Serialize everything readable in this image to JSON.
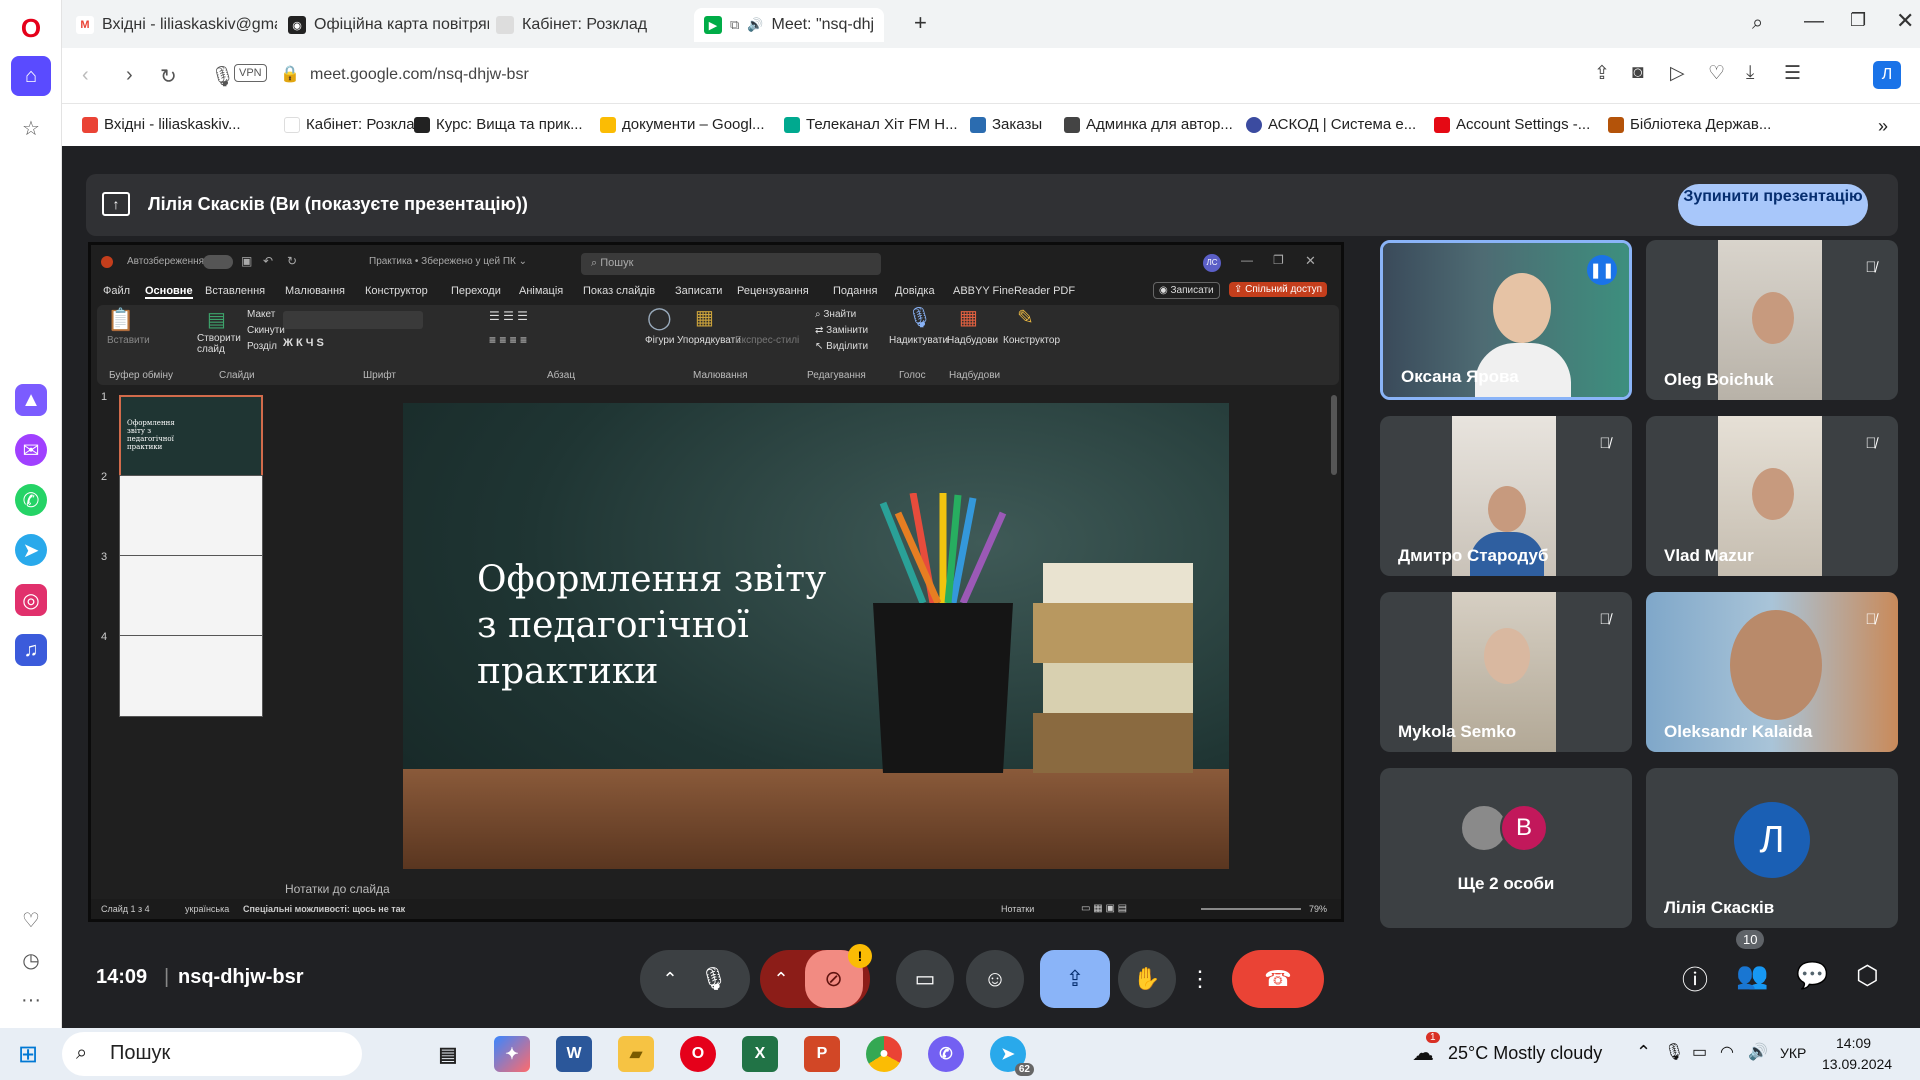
{
  "browser": {
    "tabs": [
      {
        "title": "Вхідні - liliaskaskiv@gmail",
        "icon": "gmail-icon",
        "active": false
      },
      {
        "title": "Офіційна карта повітрян",
        "icon": "map-icon",
        "active": false
      },
      {
        "title": "Кабінет: Розклад",
        "icon": "page-icon",
        "active": false
      },
      {
        "title": "Meet: \"nsq-dhjw-b",
        "icon": "meet-icon",
        "active": true
      }
    ],
    "new_tab": "+",
    "address": "meet.google.com/nsq-dhjw-bsr",
    "vpn_label": "VPN",
    "profile_initial": "Л",
    "bookmarks": [
      {
        "label": "Вхідні - liliaskaskiv...",
        "color": "#ea4335"
      },
      {
        "label": "Кабінет: Розклад",
        "color": "#ffffff"
      },
      {
        "label": "Курс: Вища та прик...",
        "color": "#222222"
      },
      {
        "label": "документи – Googl...",
        "color": "#fbbc04"
      },
      {
        "label": "Телеканал Хіт FM Н...",
        "color": "#00a98f"
      },
      {
        "label": "Заказы",
        "color": "#2b6cb0"
      },
      {
        "label": "Админка для автор...",
        "color": "#444444"
      },
      {
        "label": "АСКОД | Система е...",
        "color": "#3b4ba0"
      },
      {
        "label": "Account Settings -...",
        "color": "#e50914"
      },
      {
        "label": "Бібліотека Держав...",
        "color": "#b45309"
      }
    ]
  },
  "meet": {
    "presenting_text": "Лілія Скасків (Ви (показуєте презентацію))",
    "stop_button": "Зупинити презентацію",
    "time": "14:09",
    "meeting_code": "nsq-dhjw-bsr",
    "participant_count": "10",
    "camera_warning": "!",
    "participants": [
      {
        "name": "Оксана Ярова",
        "state": "speaking"
      },
      {
        "name": "Oleg Boichuk",
        "state": "muted"
      },
      {
        "name": "Дмитро Стародуб",
        "state": "muted"
      },
      {
        "name": "Vlad Mazur",
        "state": "muted"
      },
      {
        "name": "Mykola Semko",
        "state": "muted"
      },
      {
        "name": "Oleksandr Kalaida",
        "state": "muted"
      },
      {
        "name": "Ще 2 особи",
        "avatar_letter": "B"
      },
      {
        "name": "Лілія Скасків",
        "avatar_letter": "Л"
      }
    ]
  },
  "ppt": {
    "autosave": "Автозбереження",
    "doc_title": "Практика • Збережено у цей ПК ⌄",
    "search_placeholder": "Пошук",
    "user_initials": "ЛС",
    "menu": [
      "Файл",
      "Основне",
      "Вставлення",
      "Малювання",
      "Конструктор",
      "Переходи",
      "Анімація",
      "Показ слайдів",
      "Записати",
      "Рецензування",
      "Подання",
      "Довідка",
      "ABBYY FineReader PDF"
    ],
    "record_btn": "Записати",
    "share_btn": "Спільний доступ",
    "ribbon_groups": [
      "Буфер обміну",
      "Слайди",
      "Шрифт",
      "Абзац",
      "Малювання",
      "Редагування",
      "Голос",
      "Надбудови"
    ],
    "ribbon_buttons": {
      "paste": "Вставити",
      "new_slide": "Створити слайд",
      "layout": "Макет",
      "reset": "Скинути",
      "section": "Розділ",
      "shapes": "Фігури",
      "arrange": "Упорядкувати",
      "quick_styles": "Експрес-стилі",
      "find": "Знайти",
      "replace": "Замінити",
      "select": "Виділити",
      "dictate": "Надиктувати",
      "addins": "Надбудови",
      "designer": "Конструктор"
    },
    "slide_numbers": [
      "1",
      "2",
      "3",
      "4"
    ],
    "slide_title": "Оформлення звіту з педагогічної практики",
    "notes": "Нотатки до слайда",
    "status_slide": "Слайд 1 з 4",
    "status_lang": "українська",
    "status_access": "Спеціальні можливості: щось не так",
    "status_notes": "Нотатки",
    "zoom": "79%"
  },
  "taskbar": {
    "search": "Пошук",
    "weather": "25°C  Mostly cloudy",
    "weather_alert": "1",
    "lang": "УКР",
    "time": "14:09",
    "date": "13.09.2024",
    "telegram_badge": "62"
  },
  "colors": {
    "accent": "#8ab4f8",
    "end_call": "#ea4335",
    "present_btn": "#a8c7fa",
    "camera_off": "#f28b82"
  }
}
